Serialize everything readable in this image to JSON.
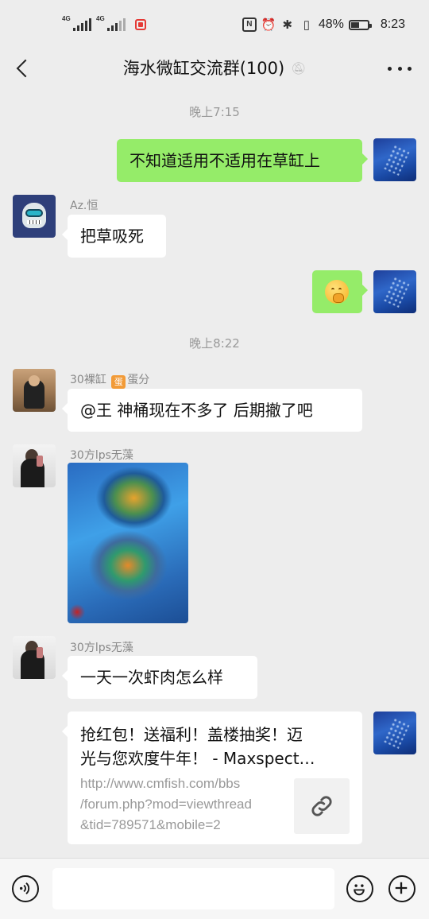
{
  "status_bar": {
    "network_1": "4G",
    "network_2": "4G",
    "battery_percent": "48%",
    "battery_level": 0.48,
    "time": "8:23",
    "icons": [
      "nfc-icon",
      "alarm-icon",
      "bluetooth-icon",
      "vibrate-icon",
      "battery-icon"
    ]
  },
  "header": {
    "title": "海水微缸交流群(100)",
    "muted_icon": "bell-off-icon",
    "back_icon": "chevron-left-icon",
    "more_icon": "more-dots-icon"
  },
  "messages": [
    {
      "type": "time",
      "text": "晚上7:15"
    },
    {
      "type": "text",
      "direction": "out",
      "text": "不知道适用不适用在草缸上"
    },
    {
      "type": "text",
      "direction": "in",
      "sender": "Az.恒",
      "text": "把草吸死"
    },
    {
      "type": "emoji",
      "direction": "out",
      "emoji": "thinking-face-emoji"
    },
    {
      "type": "time",
      "text": "晚上8:22"
    },
    {
      "type": "text",
      "direction": "in",
      "sender_prefix": "30裸缸",
      "sender_badge": "蛋",
      "sender_suffix": "蛋分",
      "text": "@王  神桶现在不多了 后期撤了吧"
    },
    {
      "type": "image",
      "direction": "in",
      "sender": "30方lps无藻",
      "image": "coral-photo"
    },
    {
      "type": "text",
      "direction": "in",
      "sender": "30方lps无藻",
      "text": "一天一次虾肉怎么样"
    },
    {
      "type": "link",
      "direction": "out",
      "title": "抢红包！送福利！盖楼抽奖！迈\n光与您欢度牛年！ - Maxspect…",
      "url": "http://www.cmfish.com/bbs\n/forum.php?mod=viewthread\n&tid=789571&mobile=2",
      "thumb_icon": "link-icon"
    }
  ],
  "input_bar": {
    "voice_icon": "voice-icon",
    "emoji_icon": "emoji-icon",
    "plus_icon": "plus-icon",
    "placeholder": ""
  },
  "colors": {
    "background": "#ededed",
    "outgoing_bubble": "#95ec69",
    "incoming_bubble": "#ffffff",
    "timestamp": "#999999"
  }
}
